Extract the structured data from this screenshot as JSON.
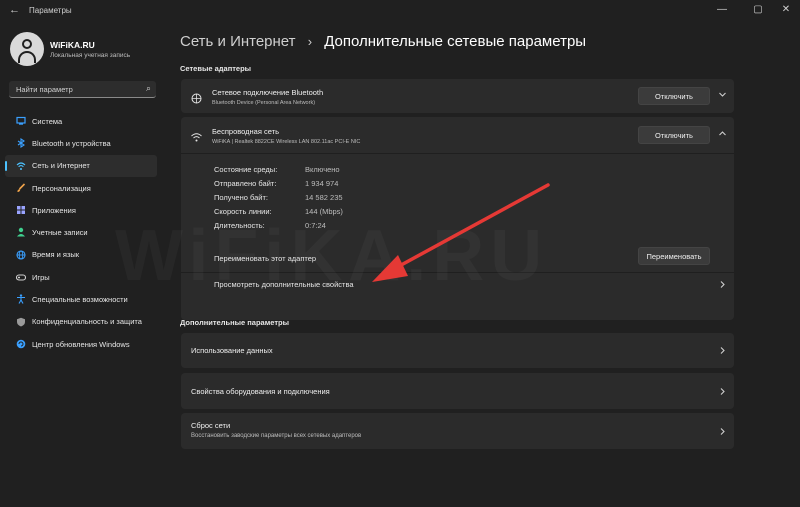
{
  "window": {
    "title": "Параметры",
    "back_icon": "←",
    "minimize": "—",
    "maximize": "▢",
    "close": "✕"
  },
  "profile": {
    "name": "WiFiKA.RU",
    "account": "Локальная учетная запись"
  },
  "search": {
    "placeholder": "Найти параметр",
    "icon": "⌕"
  },
  "sidebar": {
    "items": [
      {
        "label": "Система",
        "icon": "system-icon",
        "color": "#3aa0ff"
      },
      {
        "label": "Bluetooth и устройства",
        "icon": "bluetooth-icon",
        "color": "#3aa0ff"
      },
      {
        "label": "Сеть и Интернет",
        "icon": "wifi-icon",
        "color": "#4cc2ff",
        "active": true
      },
      {
        "label": "Персонализация",
        "icon": "brush-icon",
        "color": "#f0a34a"
      },
      {
        "label": "Приложения",
        "icon": "apps-icon",
        "color": "#9aa4ff"
      },
      {
        "label": "Учетные записи",
        "icon": "account-icon",
        "color": "#3fcf8e"
      },
      {
        "label": "Время и язык",
        "icon": "globe-icon",
        "color": "#3aa0ff"
      },
      {
        "label": "Игры",
        "icon": "gamepad-icon",
        "color": "#cfcfcf"
      },
      {
        "label": "Специальные возможности",
        "icon": "accessibility-icon",
        "color": "#3aa0ff"
      },
      {
        "label": "Конфиденциальность и защита",
        "icon": "shield-icon",
        "color": "#cfcfcf"
      },
      {
        "label": "Центр обновления Windows",
        "icon": "update-icon",
        "color": "#3aa0ff"
      }
    ]
  },
  "breadcrumb": {
    "parent": "Сеть и Интернет",
    "separator": "›",
    "current": "Дополнительные сетевые параметры"
  },
  "adapters": {
    "section_title": "Сетевые адаптеры",
    "bluetooth": {
      "title": "Сетевое подключение Bluetooth",
      "subtitle": "Bluetooth Device (Personal Area Network)",
      "button": "Отключить"
    },
    "wireless": {
      "title": "Беспроводная сеть",
      "subtitle": "WiFiKA | Realtek 8822CE Wireless LAN 802.11ac PCI-E NIC",
      "button": "Отключить",
      "details": [
        {
          "label": "Состояние среды:",
          "value": "Включено"
        },
        {
          "label": "Отправлено байт:",
          "value": "1 934 974"
        },
        {
          "label": "Получено байт:",
          "value": "14 582 235"
        },
        {
          "label": "Скорость линии:",
          "value": "144 (Mbps)"
        },
        {
          "label": "Длительность:",
          "value": "0:7:24"
        }
      ],
      "rename_label": "Переименовать этот адаптер",
      "rename_button": "Переименовать",
      "view_props": "Просмотреть дополнительные свойства"
    }
  },
  "more": {
    "section_title": "Дополнительные параметры",
    "data_usage": "Использование данных",
    "hardware": "Свойства оборудования и подключения",
    "reset_title": "Сброс сети",
    "reset_sub": "Восстановить заводские параметры всех сетевых адаптеров"
  },
  "annotation": {
    "arrow_color": "#e53935"
  },
  "watermark": "WiFiKA.RU"
}
